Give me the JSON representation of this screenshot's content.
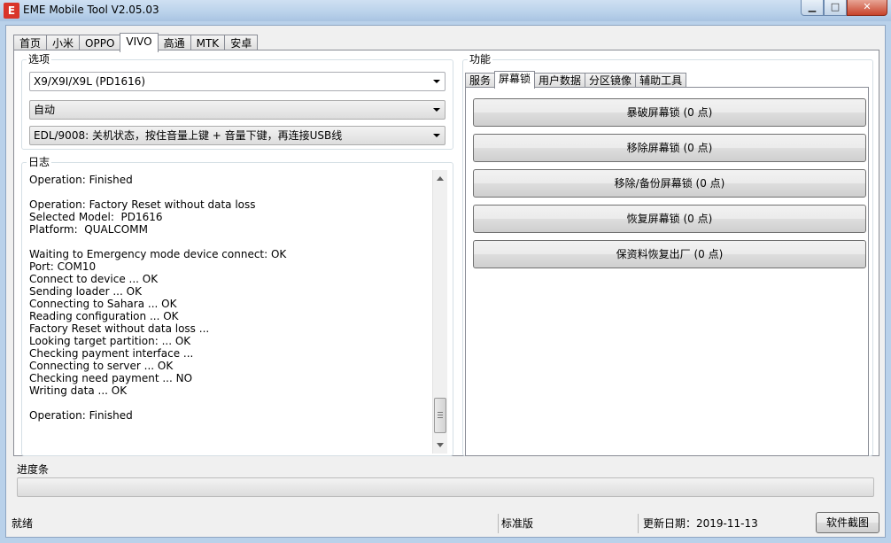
{
  "window": {
    "icon_letter": "E",
    "title": "EME Mobile Tool V2.05.03",
    "min_glyph": "▁",
    "max_glyph": "□",
    "close_glyph": "✕"
  },
  "main_tabs": [
    {
      "label": "首页",
      "active": false
    },
    {
      "label": "小米",
      "active": false
    },
    {
      "label": "OPPO",
      "active": false
    },
    {
      "label": "VIVO",
      "active": true
    },
    {
      "label": "高通",
      "active": false
    },
    {
      "label": "MTK",
      "active": false
    },
    {
      "label": "安卓",
      "active": false
    }
  ],
  "options": {
    "title": "选项",
    "model": "X9/X9I/X9L (PD1616)",
    "mode": "自动",
    "connection": "EDL/9008: 关机状态，按住音量上键 + 音量下键，再连接USB线"
  },
  "log": {
    "title": "日志",
    "lines": [
      "Operation: Finished",
      "",
      "Operation: Factory Reset without data loss",
      "Selected Model:  PD1616",
      "Platform:  QUALCOMM",
      "",
      "Waiting to Emergency mode device connect: OK",
      "Port: COM10",
      "Connect to device ... OK",
      "Sending loader ... OK",
      "Connecting to Sahara ... OK",
      "Reading configuration ... OK",
      "Factory Reset without data loss ...",
      "Looking target partition: ... OK",
      "Checking payment interface ...",
      "Connecting to server ... OK",
      "Checking need payment ... NO",
      "Writing data ... OK",
      "",
      "Operation: Finished"
    ]
  },
  "functions": {
    "title": "功能",
    "tabs": [
      {
        "label": "服务",
        "active": false
      },
      {
        "label": "屏幕锁",
        "active": true
      },
      {
        "label": "用户数据",
        "active": false
      },
      {
        "label": "分区镜像",
        "active": false
      },
      {
        "label": "辅助工具",
        "active": false
      }
    ],
    "buttons": [
      {
        "label": "暴破屏幕锁 (0 点)"
      },
      {
        "label": "移除屏幕锁 (0 点)"
      },
      {
        "label": "移除/备份屏幕锁 (0 点)"
      },
      {
        "label": "恢复屏幕锁 (0 点)"
      },
      {
        "label": "保资料恢复出厂 (0 点)"
      }
    ]
  },
  "progress": {
    "title": "进度条",
    "value": 0
  },
  "status": {
    "state": "就绪",
    "edition": "标准版",
    "update_date": "更新日期：2019-11-13",
    "screenshot_button": "软件截图"
  },
  "colors": {
    "accent": "#06b025",
    "titlebar": "#b9d1ea",
    "close": "#c7432b",
    "icon": "#d9352b"
  }
}
